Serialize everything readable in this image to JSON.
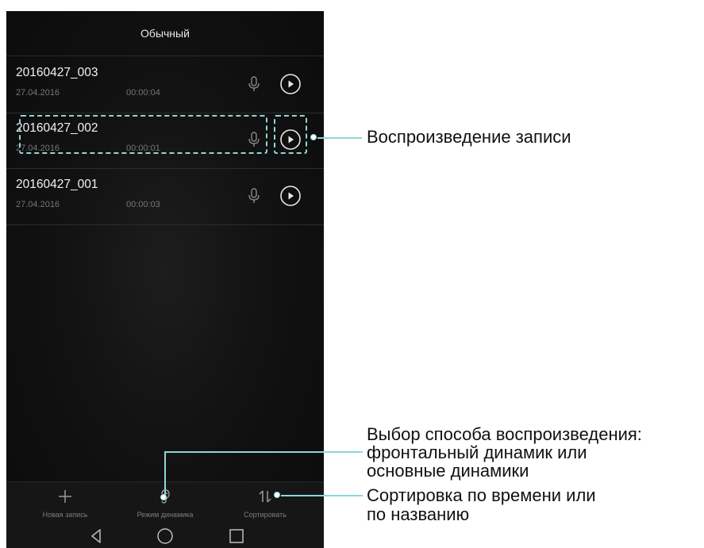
{
  "header": {
    "title": "Обычный"
  },
  "recordings": [
    {
      "name": "20160427_003",
      "date": "27.04.2016",
      "duration": "00:00:04"
    },
    {
      "name": "20160427_002",
      "date": "27.04.2016",
      "duration": "00:00:01"
    },
    {
      "name": "20160427_001",
      "date": "27.04.2016",
      "duration": "00:00:03"
    }
  ],
  "toolbar": {
    "new_label": "Новая запись",
    "speaker_label": "Режим динамика",
    "sort_label": "Сортировать"
  },
  "annotations": {
    "playback": "Воспроизведение записи",
    "speaker_line1": "Выбор способа воспроизведения:",
    "speaker_line2": "фронтальный динамик или",
    "speaker_line3": "основные динамики",
    "sort_line1": "Сортировка по времени или",
    "sort_line2": "по названию"
  },
  "icons": {
    "mic": "microphone-icon",
    "play": "play-icon",
    "add": "plus-icon",
    "speaker": "ear-icon",
    "sort": "sort-arrows-icon",
    "back": "back-triangle-icon",
    "home": "home-circle-icon",
    "recents": "recents-square-icon"
  },
  "colors": {
    "highlight": "#8fd6d6",
    "background": "#121212",
    "text": "#f2f2f2",
    "secondary": "#777777"
  }
}
